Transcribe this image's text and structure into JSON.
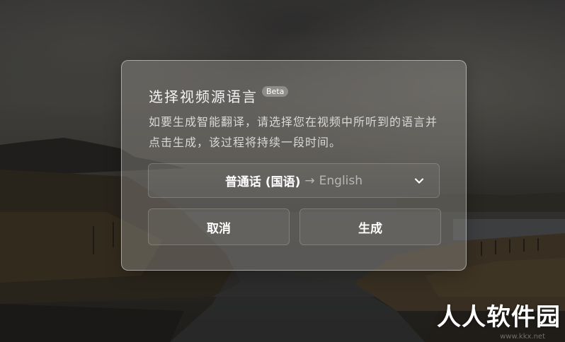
{
  "dialog": {
    "title": "选择视频源语言",
    "badge": "Beta",
    "description": "如要生成智能翻译，请选择您在视频中所听到的语言并点击生成，该过程将持续一段时间。",
    "language_select": {
      "source": "普通话 (国语)",
      "arrow": "→",
      "target": "English",
      "icon": "chevron-down-icon"
    },
    "buttons": {
      "cancel": "取消",
      "generate": "生成"
    }
  },
  "watermark": {
    "text": "人人软件园",
    "url": "www.kkx.net"
  },
  "colors": {
    "dialog_bg": "#969490",
    "text_primary": "#ffffff",
    "text_secondary": "#d9d8d6",
    "text_muted": "#b9b7b4"
  }
}
